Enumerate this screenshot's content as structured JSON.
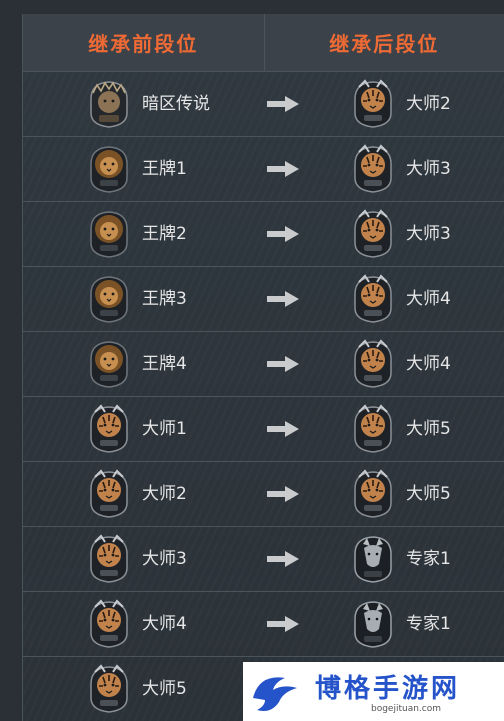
{
  "header": {
    "before": "继承前段位",
    "after": "继承后段位"
  },
  "rows": [
    {
      "before": {
        "label": "暗区传说",
        "icon": "legend-rank-icon"
      },
      "after": {
        "label": "大师2",
        "icon": "tiger-rank-icon"
      }
    },
    {
      "before": {
        "label": "王牌1",
        "icon": "lion-rank-icon"
      },
      "after": {
        "label": "大师3",
        "icon": "tiger-rank-icon"
      }
    },
    {
      "before": {
        "label": "王牌2",
        "icon": "lion-rank-icon"
      },
      "after": {
        "label": "大师3",
        "icon": "tiger-rank-icon"
      }
    },
    {
      "before": {
        "label": "王牌3",
        "icon": "lion-rank-icon"
      },
      "after": {
        "label": "大师4",
        "icon": "tiger-rank-icon"
      }
    },
    {
      "before": {
        "label": "王牌4",
        "icon": "lion-rank-icon"
      },
      "after": {
        "label": "大师4",
        "icon": "tiger-rank-icon"
      }
    },
    {
      "before": {
        "label": "大师1",
        "icon": "tiger-rank-icon"
      },
      "after": {
        "label": "大师5",
        "icon": "tiger-rank-icon"
      }
    },
    {
      "before": {
        "label": "大师2",
        "icon": "tiger-rank-icon"
      },
      "after": {
        "label": "大师5",
        "icon": "tiger-rank-icon"
      }
    },
    {
      "before": {
        "label": "大师3",
        "icon": "tiger-rank-icon"
      },
      "after": {
        "label": "专家1",
        "icon": "wolf-rank-icon"
      }
    },
    {
      "before": {
        "label": "大师4",
        "icon": "tiger-rank-icon"
      },
      "after": {
        "label": "专家1",
        "icon": "wolf-rank-icon"
      }
    },
    {
      "before": {
        "label": "大师5",
        "icon": "tiger-rank-icon"
      },
      "after": {
        "label": "",
        "icon": ""
      }
    }
  ],
  "watermark": {
    "text": "博格手游网",
    "url": "bogejituan.com",
    "icon": "bird-logo-icon"
  },
  "colors": {
    "header_text": "#ef6a34",
    "lion": "#a9743e",
    "tiger": "#c1824b",
    "wolf": "#a7adb3",
    "legend": "#8c7355",
    "watermark_text": "#2553c9"
  }
}
